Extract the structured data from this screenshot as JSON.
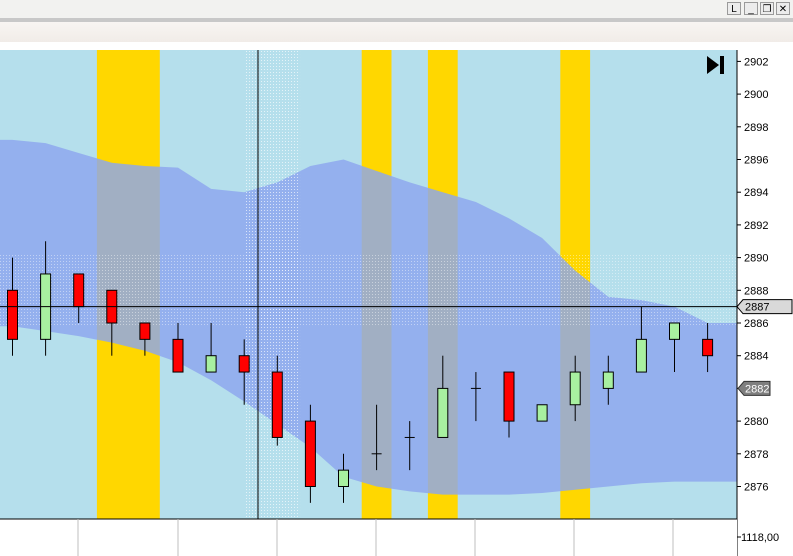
{
  "window": {
    "buttons": [
      {
        "name": "layout-button",
        "label": "L"
      },
      {
        "name": "minimize-button",
        "label": "_"
      },
      {
        "name": "restore-button",
        "label": "❐"
      },
      {
        "name": "close-button",
        "label": "✕"
      }
    ]
  },
  "chart_data": {
    "type": "candlestick",
    "title": "",
    "xlabel": "",
    "ylabel": "",
    "ylim": [
      2874.5,
      2903.5
    ],
    "grid": false,
    "y_ticks": [
      2876,
      2878,
      2880,
      2882,
      2884,
      2886,
      2888,
      2890,
      2892,
      2894,
      2896,
      2898,
      2900,
      2902
    ],
    "y_tick_labels": [
      "2876",
      "2878",
      "2880",
      "2882",
      "2884",
      "2886",
      "2888",
      "2890",
      "2892",
      "2894",
      "2896",
      "2898",
      "2900",
      "2902"
    ],
    "current_price_label": "2887",
    "current_price": 2887.0,
    "marker_price_label": "2882",
    "marker_price": 2882.0,
    "lower_pane_label": "1118,00",
    "bar_index": [
      1,
      2,
      3,
      4,
      5,
      6,
      7,
      8,
      9,
      10,
      11,
      12,
      13,
      14,
      15,
      16,
      17,
      18,
      19,
      20,
      21,
      22
    ],
    "candles": [
      {
        "open": 2888,
        "high": 2890,
        "low": 2884,
        "close": 2885,
        "color": "red"
      },
      {
        "open": 2885,
        "high": 2891,
        "low": 2884,
        "close": 2889,
        "color": "green"
      },
      {
        "open": 2889,
        "high": 2889,
        "low": 2886,
        "close": 2887,
        "color": "red"
      },
      {
        "open": 2888,
        "high": 2888,
        "low": 2884,
        "close": 2886,
        "color": "red"
      },
      {
        "open": 2886,
        "high": 2886,
        "low": 2884,
        "close": 2885,
        "color": "red"
      },
      {
        "open": 2885,
        "high": 2886,
        "low": 2883,
        "close": 2883,
        "color": "red"
      },
      {
        "open": 2883,
        "high": 2886,
        "low": 2883,
        "close": 2884,
        "color": "green"
      },
      {
        "open": 2884,
        "high": 2885,
        "low": 2881,
        "close": 2883,
        "color": "red"
      },
      {
        "open": 2883,
        "high": 2884,
        "low": 2878.5,
        "close": 2879,
        "color": "red"
      },
      {
        "open": 2880,
        "high": 2881,
        "low": 2875,
        "close": 2876,
        "color": "red"
      },
      {
        "open": 2876,
        "high": 2878,
        "low": 2875,
        "close": 2877,
        "color": "green"
      },
      {
        "open": 2878,
        "high": 2881,
        "low": 2877,
        "close": 2878,
        "color": "doji"
      },
      {
        "open": 2879,
        "high": 2880,
        "low": 2877,
        "close": 2879,
        "color": "doji"
      },
      {
        "open": 2879,
        "high": 2884,
        "low": 2879,
        "close": 2882,
        "color": "green"
      },
      {
        "open": 2882,
        "high": 2883,
        "low": 2880,
        "close": 2882,
        "color": "doji"
      },
      {
        "open": 2883,
        "high": 2883,
        "low": 2879,
        "close": 2880,
        "color": "red"
      },
      {
        "open": 2880,
        "high": 2881,
        "low": 2880,
        "close": 2881,
        "color": "green"
      },
      {
        "open": 2881,
        "high": 2884,
        "low": 2880,
        "close": 2883,
        "color": "green"
      },
      {
        "open": 2882,
        "high": 2884,
        "low": 2881,
        "close": 2883,
        "color": "green"
      },
      {
        "open": 2883,
        "high": 2887,
        "low": 2883,
        "close": 2885,
        "color": "green"
      },
      {
        "open": 2885,
        "high": 2886,
        "low": 2883,
        "close": 2886,
        "color": "green"
      },
      {
        "open": 2885,
        "high": 2886,
        "low": 2883,
        "close": 2884,
        "color": "red"
      }
    ],
    "band_upper": [
      2897.2,
      2897.0,
      2896.4,
      2895.8,
      2895.6,
      2895.5,
      2894.2,
      2894.0,
      2894.6,
      2895.6,
      2896.0,
      2895.3,
      2894.6,
      2894.0,
      2893.4,
      2892.4,
      2891.2,
      2889.2,
      2887.6,
      2887.4,
      2887.0,
      2886.0
    ],
    "band_lower": [
      2885.8,
      2885.5,
      2885.2,
      2884.8,
      2884.3,
      2883.6,
      2882.5,
      2881.2,
      2879.8,
      2878.4,
      2876.6,
      2876.0,
      2875.7,
      2875.5,
      2875.5,
      2875.5,
      2875.6,
      2875.8,
      2876.0,
      2876.2,
      2876.3,
      2876.3
    ],
    "highlight_columns": [
      {
        "from": 3.55,
        "to": 5.45
      },
      {
        "from": 11.55,
        "to": 12.45
      },
      {
        "from": 13.55,
        "to": 14.45
      },
      {
        "from": 17.55,
        "to": 18.45
      }
    ],
    "crosshair": {
      "bar": 8.6,
      "price": 2887.0
    },
    "colors": {
      "background": "#b5dfec",
      "band": "#8ca6ee",
      "highlight": "#ffd700",
      "bull_candle": "#a8f0a0",
      "bear_candle": "#ff0000",
      "crosshair": "#000000",
      "axis_label_fill": "#d9d9d9",
      "marker_label_fill": "#7f7f7f"
    },
    "icons": [
      "skip-to-end-icon"
    ]
  }
}
